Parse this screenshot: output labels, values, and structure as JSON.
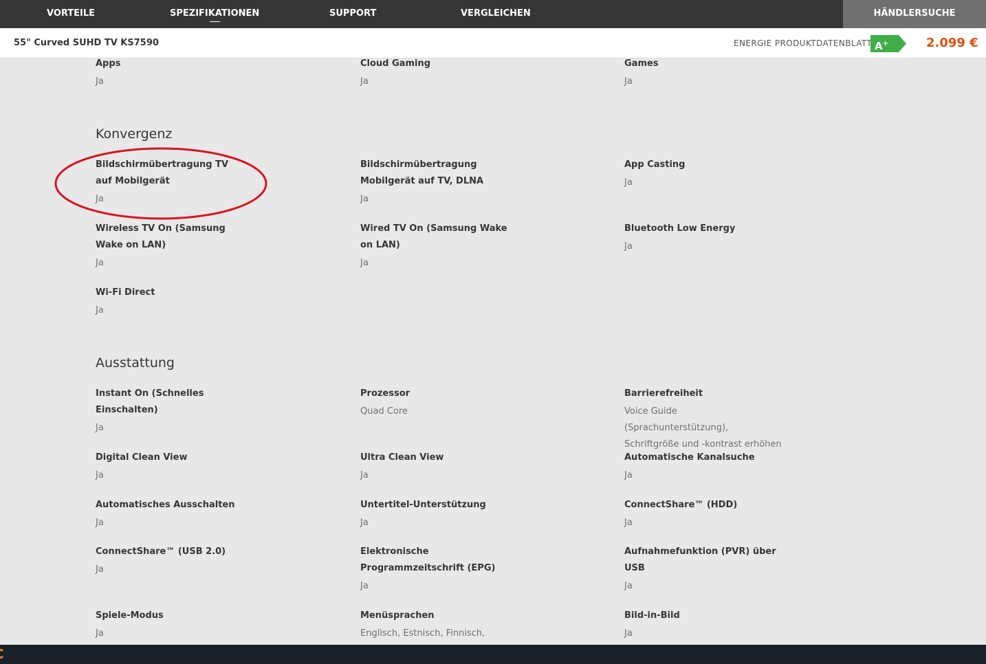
{
  "nav": {
    "items": [
      "VORTEILE",
      "SPEZIFIKATIONEN",
      "SUPPORT",
      "VERGLEICHEN"
    ],
    "active": "SPEZIFIKATIONEN",
    "dealer": "HÄNDLERSUCHE"
  },
  "product": {
    "name": "55\" Curved SUHD TV KS7590",
    "energy_label": "ENERGIE PRODUKTDATENBLATT",
    "energy_class": "A",
    "energy_class_sup": "+",
    "energy_color": "#3fae49",
    "price": "2.099 €",
    "price_color": "#e0500e"
  },
  "top_specs": [
    {
      "label": "Apps",
      "value": "Ja"
    },
    {
      "label": "Cloud Gaming",
      "value": "Ja"
    },
    {
      "label": "Games",
      "value": "Ja"
    }
  ],
  "konvergenz": {
    "title": "Konvergenz",
    "items": [
      {
        "label": "Bildschirmübertragung TV auf Mobilgerät",
        "value": "Ja"
      },
      {
        "label": "Bildschirmübertragung Mobilgerät auf TV, DLNA",
        "value": "Ja"
      },
      {
        "label": "App Casting",
        "value": "Ja"
      },
      {
        "label": "Wireless TV On (Samsung Wake on LAN)",
        "value": "Ja"
      },
      {
        "label": "Wired TV On (Samsung Wake on LAN)",
        "value": "Ja"
      },
      {
        "label": "Bluetooth Low Energy",
        "value": "Ja"
      },
      {
        "label": "Wi-Fi Direct",
        "value": "Ja"
      }
    ]
  },
  "ausstattung": {
    "title": "Ausstattung",
    "items": [
      {
        "label": "Instant On (Schnelles Einschalten)",
        "value": "Ja"
      },
      {
        "label": "Prozessor",
        "value": "Quad Core"
      },
      {
        "label": "Barrierefreiheit",
        "value": "Voice Guide (Sprachunterstützung), Schriftgröße und -kontrast erhöhen"
      },
      {
        "label": "Digital Clean View",
        "value": "Ja"
      },
      {
        "label": "Ultra Clean View",
        "value": "Ja"
      },
      {
        "label": "Automatische Kanalsuche",
        "value": "Ja"
      },
      {
        "label": "Automatisches Ausschalten",
        "value": "Ja"
      },
      {
        "label": "Untertitel-Unterstützung",
        "value": "Ja"
      },
      {
        "label": "ConnectShare™ (HDD)",
        "value": "Ja"
      },
      {
        "label": "ConnectShare™ (USB 2.0)",
        "value": "Ja"
      },
      {
        "label": "Elektronische Programmzeitschrift (EPG)",
        "value": "Ja"
      },
      {
        "label": "Aufnahmefunktion (PVR) über USB",
        "value": "Ja"
      },
      {
        "label": "Spiele-Modus",
        "value": "Ja"
      },
      {
        "label": "Menüsprachen",
        "value": "Englisch, Estnisch, Finnisch,"
      },
      {
        "label": "Bild-in-Bild",
        "value": "Ja"
      }
    ]
  },
  "annotation_color": "#d9141e"
}
